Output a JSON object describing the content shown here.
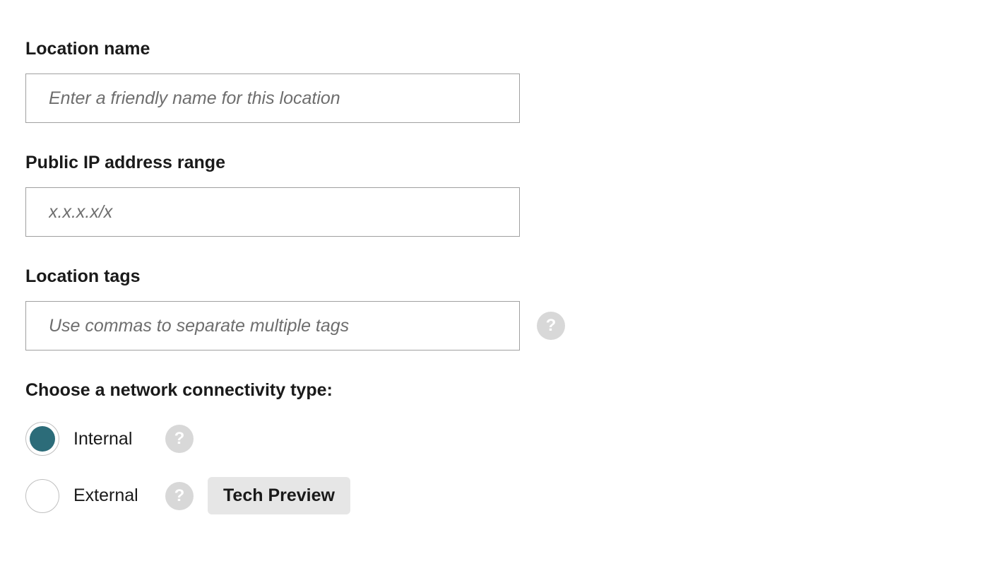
{
  "locationName": {
    "label": "Location name",
    "placeholder": "Enter a friendly name for this location",
    "value": ""
  },
  "publicIp": {
    "label": "Public IP address range",
    "placeholder": "x.x.x.x/x",
    "value": ""
  },
  "locationTags": {
    "label": "Location tags",
    "placeholder": "Use commas to separate multiple tags",
    "value": ""
  },
  "connectivity": {
    "label": "Choose a network connectivity type:",
    "options": {
      "internal": {
        "label": "Internal",
        "selected": true
      },
      "external": {
        "label": "External",
        "selected": false,
        "badge": "Tech Preview"
      }
    }
  },
  "helpGlyph": "?"
}
